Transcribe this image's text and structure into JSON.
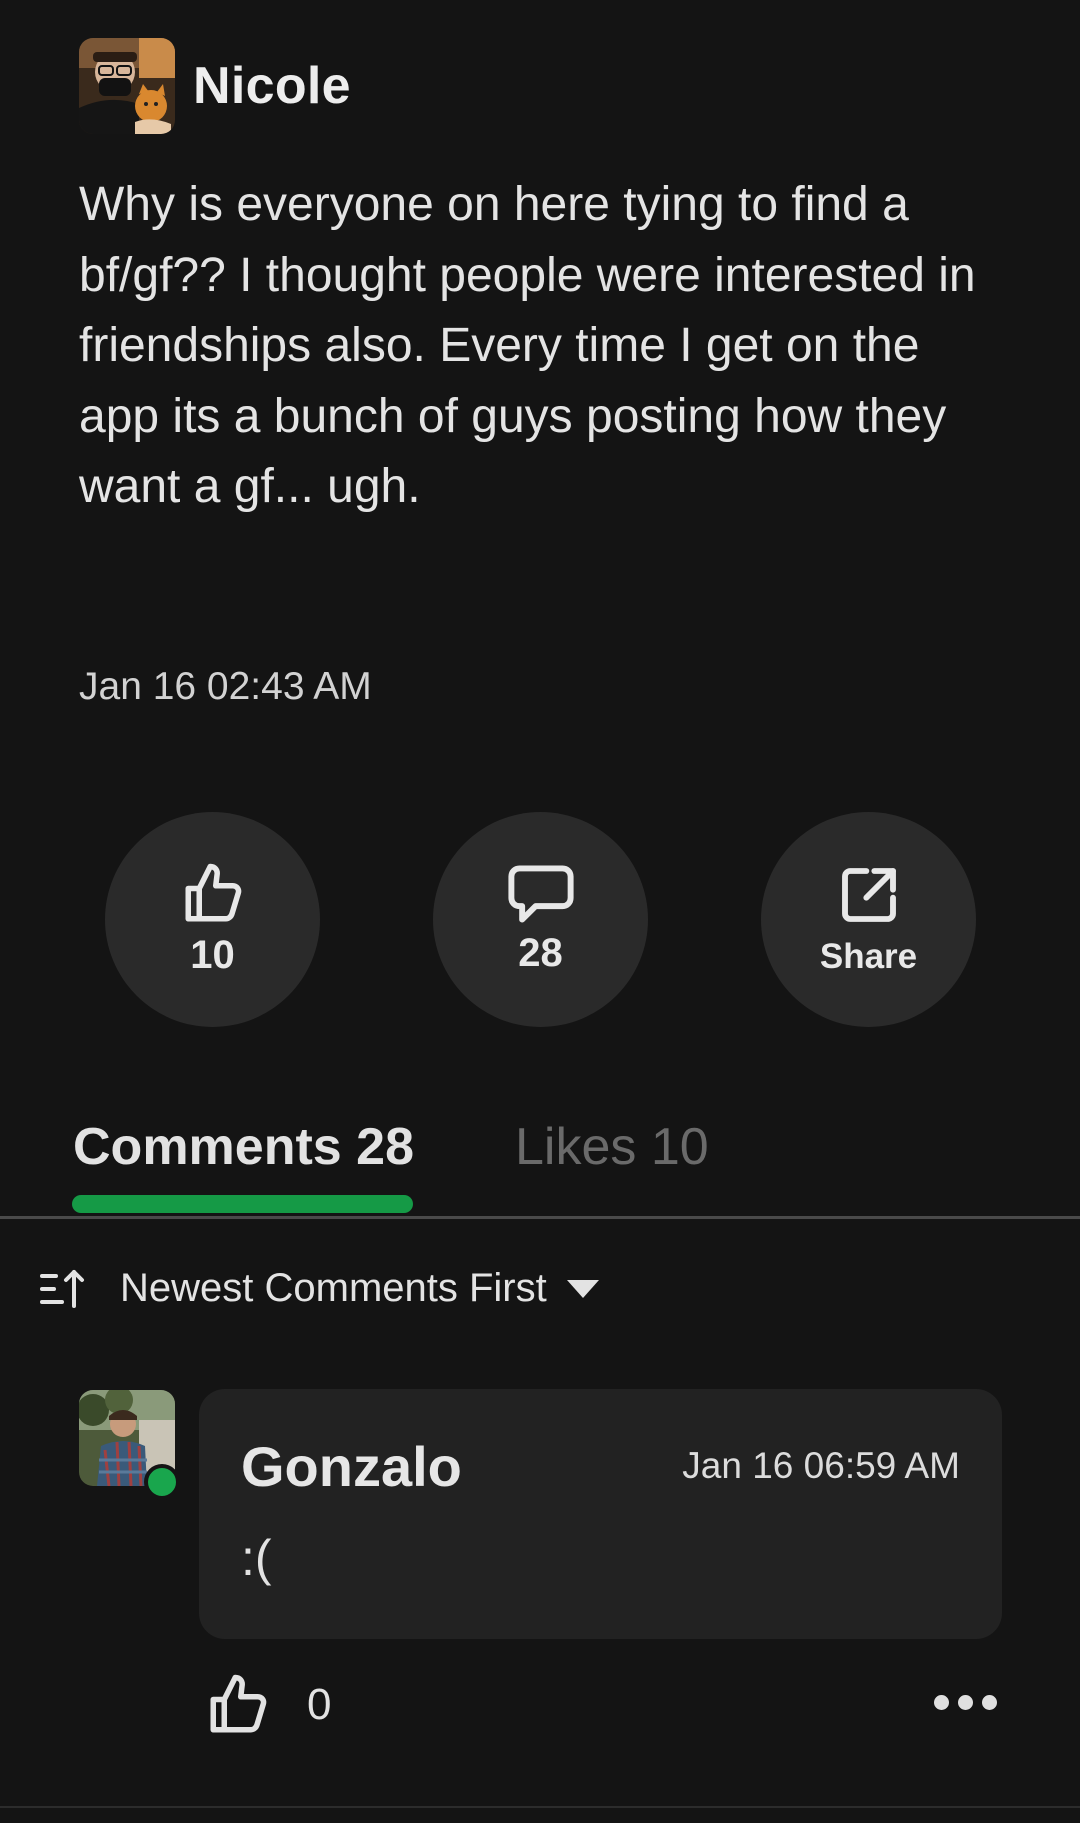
{
  "post": {
    "author": "Nicole",
    "avatar_icon": "user-avatar-photo",
    "body": "Why is everyone on here tying to find a bf/gf?? I thought people were interested in friendships also. Every time I get on the app its a bunch of guys posting how they want a gf... ugh.",
    "timestamp": "Jan 16 02:43 AM"
  },
  "actions": {
    "like_count": "10",
    "comment_count": "28",
    "share_label": "Share",
    "like_icon": "thumbs-up-icon",
    "comment_icon": "speech-bubble-icon",
    "share_icon": "external-share-icon"
  },
  "tabs": [
    {
      "label": "Comments 28",
      "active": true
    },
    {
      "label": "Likes 10",
      "active": false
    }
  ],
  "sort": {
    "label": "Newest Comments First",
    "icon": "sort-icon"
  },
  "comments": [
    {
      "author": "Gonzalo",
      "timestamp": "Jan 16 06:59 AM",
      "text": ":(",
      "likes": "0",
      "online": true
    }
  ],
  "colors": {
    "background": "#141414",
    "button_bg": "#2a2a2a",
    "accent_green": "#159a46",
    "online_green": "#19a64d",
    "bubble_bg": "#222222"
  }
}
